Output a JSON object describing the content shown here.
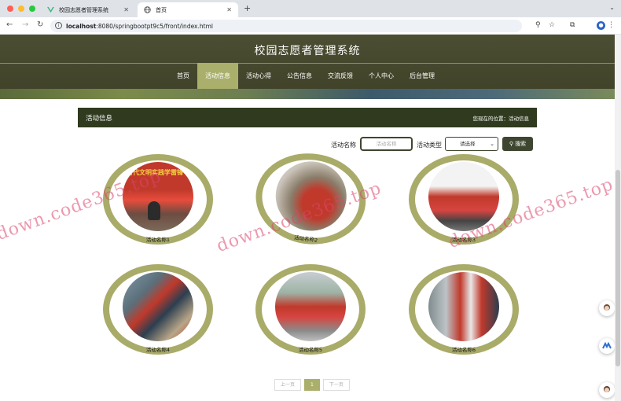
{
  "browser": {
    "tabs": [
      {
        "title": "校园志愿者管理系统"
      },
      {
        "title": "首页"
      }
    ],
    "url_host": "localhost",
    "url_rest": ":8080/springbootpt9c5/front/index.html"
  },
  "site": {
    "title": "校园志愿者管理系统",
    "nav": [
      "首页",
      "活动信息",
      "活动心得",
      "公告信息",
      "交流反馈",
      "个人中心",
      "后台管理"
    ],
    "active_nav": "活动信息"
  },
  "section": {
    "title": "活动信息",
    "breadcrumb": "您现在的位置：活动信息"
  },
  "search": {
    "name_label": "活动名称",
    "name_placeholder": "活动名称",
    "type_label": "活动类型",
    "type_selected": "请选择",
    "button_label": "搜索"
  },
  "activities": [
    {
      "name": "活动名称1",
      "photo_text": "时代文明实践学雷锋"
    },
    {
      "name": "活动名称2",
      "photo_text": ""
    },
    {
      "name": "活动名称3",
      "photo_text": ""
    },
    {
      "name": "活动名称4",
      "photo_text": ""
    },
    {
      "name": "活动名称5",
      "photo_text": ""
    },
    {
      "name": "活动名称6",
      "photo_text": ""
    }
  ],
  "pager": {
    "prev": "上一页",
    "current": "1",
    "next": "下一页"
  },
  "watermark": "down.code365.top",
  "colors": {
    "header": "#4c4e33",
    "accent": "#aab06b",
    "ring": "#a9ab69",
    "section": "#2f3a1e"
  }
}
